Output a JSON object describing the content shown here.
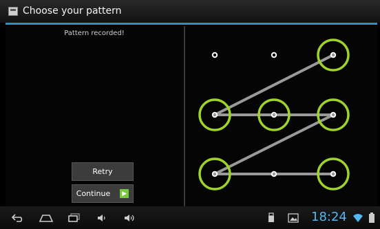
{
  "window": {
    "title": "Choose your pattern"
  },
  "left_panel": {
    "status": "Pattern recorded!",
    "retry_label": "Retry",
    "continue_label": "Continue"
  },
  "pattern": {
    "grid": "3x3",
    "sequence": [
      2,
      3,
      4,
      5,
      6,
      8
    ],
    "accent_color": "#a0d22c",
    "line_color": "#9a9a9a"
  },
  "status_bar": {
    "time": "18:24"
  },
  "colors": {
    "accent_blue": "#2f8fc0",
    "clock_blue": "#56b7f0",
    "continue_arrow": "#77c93b"
  }
}
